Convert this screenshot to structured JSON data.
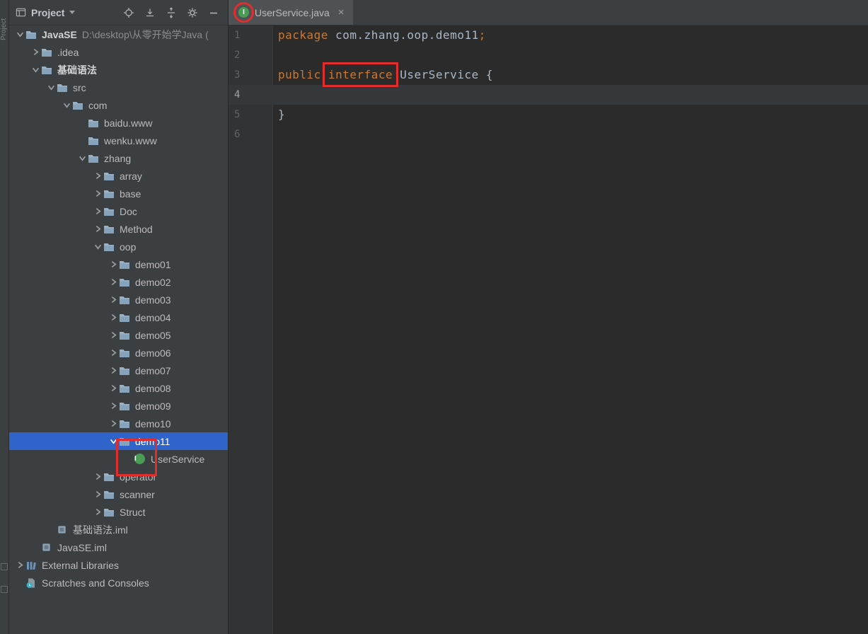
{
  "strip": {
    "label": "Project"
  },
  "toolbar": {
    "title": "Project",
    "icons": [
      "locate-file",
      "collapse-all",
      "expand-collapse",
      "settings-gear",
      "hide-panel"
    ]
  },
  "project_panel": {
    "header": {
      "title": "Project"
    },
    "tree": [
      {
        "label": "JavaSE",
        "path": "D:\\desktop\\从零开始学Java (",
        "level": 0,
        "expand": "open",
        "icon": "folder",
        "bold": true
      },
      {
        "label": ".idea",
        "level": 1,
        "expand": "closed",
        "icon": "folder"
      },
      {
        "label": "基础语法",
        "level": 1,
        "expand": "open",
        "icon": "folder",
        "bold": true
      },
      {
        "label": "src",
        "level": 2,
        "expand": "open",
        "icon": "folder"
      },
      {
        "label": "com",
        "level": 3,
        "expand": "open",
        "icon": "package"
      },
      {
        "label": "baidu.www",
        "level": 4,
        "expand": "none",
        "icon": "package"
      },
      {
        "label": "wenku.www",
        "level": 4,
        "expand": "none",
        "icon": "package"
      },
      {
        "label": "zhang",
        "level": 4,
        "expand": "open",
        "icon": "package"
      },
      {
        "label": "array",
        "level": 5,
        "expand": "closed",
        "icon": "package"
      },
      {
        "label": "base",
        "level": 5,
        "expand": "closed",
        "icon": "package"
      },
      {
        "label": "Doc",
        "level": 5,
        "expand": "closed",
        "icon": "package"
      },
      {
        "label": "Method",
        "level": 5,
        "expand": "closed",
        "icon": "package"
      },
      {
        "label": "oop",
        "level": 5,
        "expand": "open",
        "icon": "package"
      },
      {
        "label": "demo01",
        "level": 6,
        "expand": "closed",
        "icon": "package"
      },
      {
        "label": "demo02",
        "level": 6,
        "expand": "closed",
        "icon": "package"
      },
      {
        "label": "demo03",
        "level": 6,
        "expand": "closed",
        "icon": "package"
      },
      {
        "label": "demo04",
        "level": 6,
        "expand": "closed",
        "icon": "package"
      },
      {
        "label": "demo05",
        "level": 6,
        "expand": "closed",
        "icon": "package"
      },
      {
        "label": "demo06",
        "level": 6,
        "expand": "closed",
        "icon": "package"
      },
      {
        "label": "demo07",
        "level": 6,
        "expand": "closed",
        "icon": "package"
      },
      {
        "label": "demo08",
        "level": 6,
        "expand": "closed",
        "icon": "package"
      },
      {
        "label": "demo09",
        "level": 6,
        "expand": "closed",
        "icon": "package"
      },
      {
        "label": "demo10",
        "level": 6,
        "expand": "closed",
        "icon": "package"
      },
      {
        "label": "demo11",
        "level": 6,
        "expand": "open",
        "icon": "package",
        "selected": true
      },
      {
        "label": "UserService",
        "level": 7,
        "expand": "none",
        "icon": "interface"
      },
      {
        "label": "operator",
        "level": 5,
        "expand": "closed",
        "icon": "package"
      },
      {
        "label": "scanner",
        "level": 5,
        "expand": "closed",
        "icon": "package"
      },
      {
        "label": "Struct",
        "level": 5,
        "expand": "closed",
        "icon": "package"
      },
      {
        "label": "基础语法.iml",
        "level": 2,
        "expand": "none",
        "icon": "iml"
      },
      {
        "label": "JavaSE.iml",
        "level": 1,
        "expand": "none",
        "icon": "iml"
      },
      {
        "label": "External Libraries",
        "level": 0,
        "expand": "closed",
        "icon": "libraries"
      },
      {
        "label": "Scratches and Consoles",
        "level": 0,
        "expand": "none",
        "icon": "scratches"
      }
    ]
  },
  "editor": {
    "tab": {
      "label": "UserService.java",
      "close_glyph": "×"
    },
    "lines": [
      {
        "num": "1",
        "tokens": [
          {
            "text": "package ",
            "type": "kw"
          },
          {
            "text": "com.zhang.oop.demo11",
            "type": "plain"
          },
          {
            "text": ";",
            "type": "semi"
          }
        ]
      },
      {
        "num": "2",
        "tokens": []
      },
      {
        "num": "3",
        "tokens": [
          {
            "text": "public ",
            "type": "kw"
          },
          {
            "text": "interface",
            "type": "kw",
            "boxed": true
          },
          {
            "text": " UserService {",
            "type": "plain"
          }
        ]
      },
      {
        "num": "4",
        "tokens": [],
        "current": true
      },
      {
        "num": "5",
        "tokens": [
          {
            "text": "}",
            "type": "plain"
          }
        ]
      },
      {
        "num": "6",
        "tokens": []
      }
    ]
  },
  "colors": {
    "keyword": "#cc7832",
    "plain_text": "#a9b7c6",
    "semicolon": "#cc7832",
    "selection_blue": "#2f65ca",
    "annotation_red": "#e02d2d",
    "interface_green": "#499c54",
    "panel_bg": "#3c3f41",
    "editor_bg": "#2b2b2b"
  }
}
